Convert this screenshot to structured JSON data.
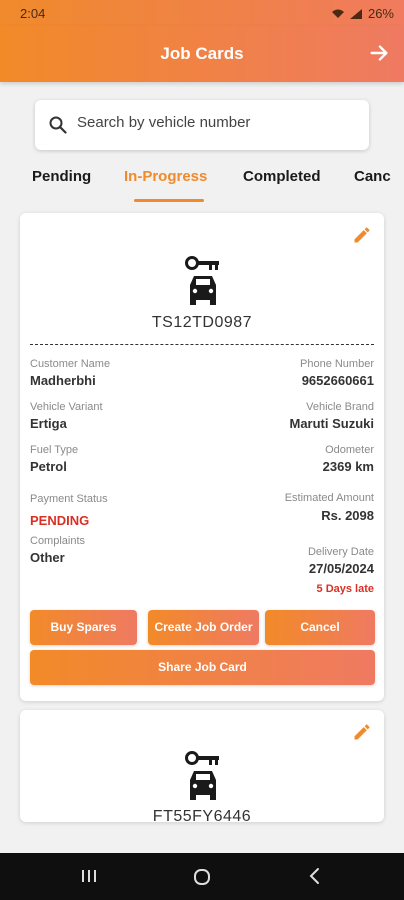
{
  "status_bar": {
    "time": "2:04",
    "battery": "26%"
  },
  "header": {
    "title": "Job Cards"
  },
  "search": {
    "placeholder": "Search by vehicle number"
  },
  "tabs": [
    {
      "label": "Pending"
    },
    {
      "label": "In-Progress"
    },
    {
      "label": "Completed"
    },
    {
      "label": "Canc"
    }
  ],
  "active_tab": "In-Progress",
  "job_cards": [
    {
      "plate": "TS12TD0987",
      "customer_name_label": "Customer Name",
      "customer_name": "Madherbhi",
      "phone_label": "Phone Number",
      "phone": "9652660661",
      "variant_label": "Vehicle Variant",
      "variant": "Ertiga",
      "brand_label": "Vehicle Brand",
      "brand": "Maruti Suzuki",
      "fuel_label": "Fuel Type",
      "fuel": "Petrol",
      "odometer_label": "Odometer",
      "odometer": "2369 km",
      "payment_label": "Payment Status",
      "payment": "PENDING",
      "amount_label": "Estimated Amount",
      "amount": "Rs. 2098",
      "complaints_label": "Complaints",
      "complaints": "Other",
      "delivery_label": "Delivery Date",
      "delivery": "27/05/2024",
      "late": "5 Days late",
      "buttons": {
        "buy_spares": "Buy Spares",
        "create_job_order": "Create Job Order",
        "cancel": "Cancel",
        "share": "Share Job Card"
      }
    },
    {
      "plate": "FT55FY6446"
    }
  ],
  "colors": {
    "accent": "#f08a2c",
    "accent_end": "#ef7a62",
    "danger": "#d93025"
  }
}
